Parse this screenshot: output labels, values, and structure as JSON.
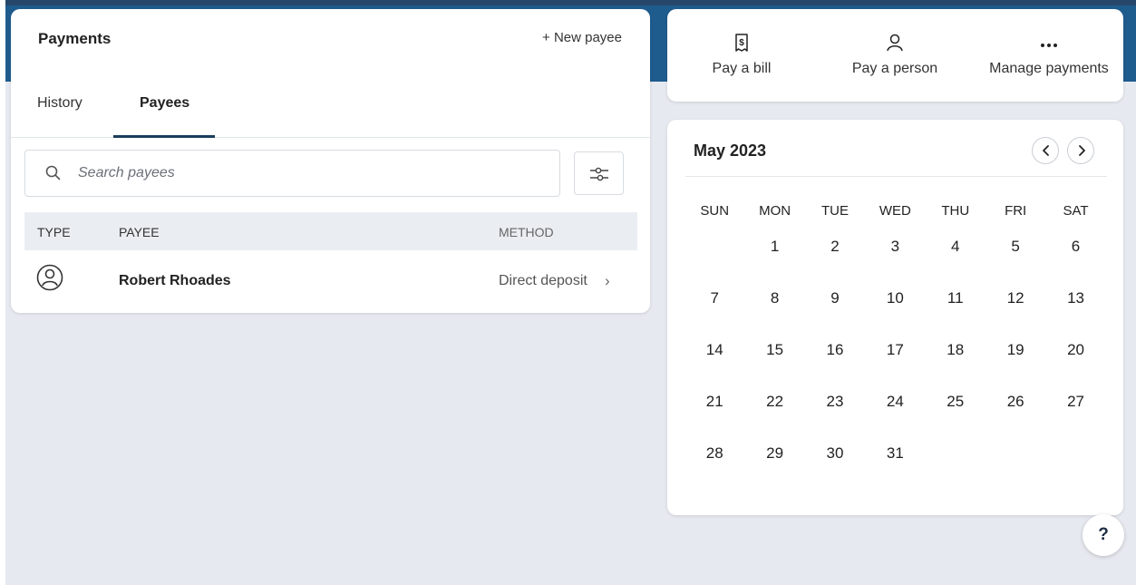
{
  "payments": {
    "title": "Payments",
    "new_payee_label": "+ New payee",
    "tabs": [
      {
        "label": "History",
        "active": false
      },
      {
        "label": "Payees",
        "active": true
      }
    ],
    "search": {
      "placeholder": "Search payees",
      "value": ""
    },
    "table": {
      "columns": [
        "TYPE",
        "PAYEE",
        "METHOD"
      ],
      "rows": [
        {
          "type_icon": "person-icon",
          "payee": "Robert Rhoades",
          "method": "Direct deposit"
        }
      ]
    }
  },
  "actions": [
    {
      "label": "Pay a bill",
      "icon": "bill-dollar-icon"
    },
    {
      "label": "Pay a person",
      "icon": "person-icon"
    },
    {
      "label": "Manage payments",
      "icon": "more-horizontal-icon"
    }
  ],
  "calendar": {
    "month_label": "May 2023",
    "weekdays": [
      "SUN",
      "MON",
      "TUE",
      "WED",
      "THU",
      "FRI",
      "SAT"
    ],
    "weeks": [
      [
        "",
        "1",
        "2",
        "3",
        "4",
        "5",
        "6"
      ],
      [
        "7",
        "8",
        "9",
        "10",
        "11",
        "12",
        "13"
      ],
      [
        "14",
        "15",
        "16",
        "17",
        "18",
        "19",
        "20"
      ],
      [
        "21",
        "22",
        "23",
        "24",
        "25",
        "26",
        "27"
      ],
      [
        "28",
        "29",
        "30",
        "31",
        "",
        "",
        ""
      ]
    ]
  },
  "help": {
    "label": "?"
  },
  "colors": {
    "header_band": "#1f5c8e",
    "page_background": "#e6e9ef",
    "active_tab_underline": "#1a3d5c"
  }
}
